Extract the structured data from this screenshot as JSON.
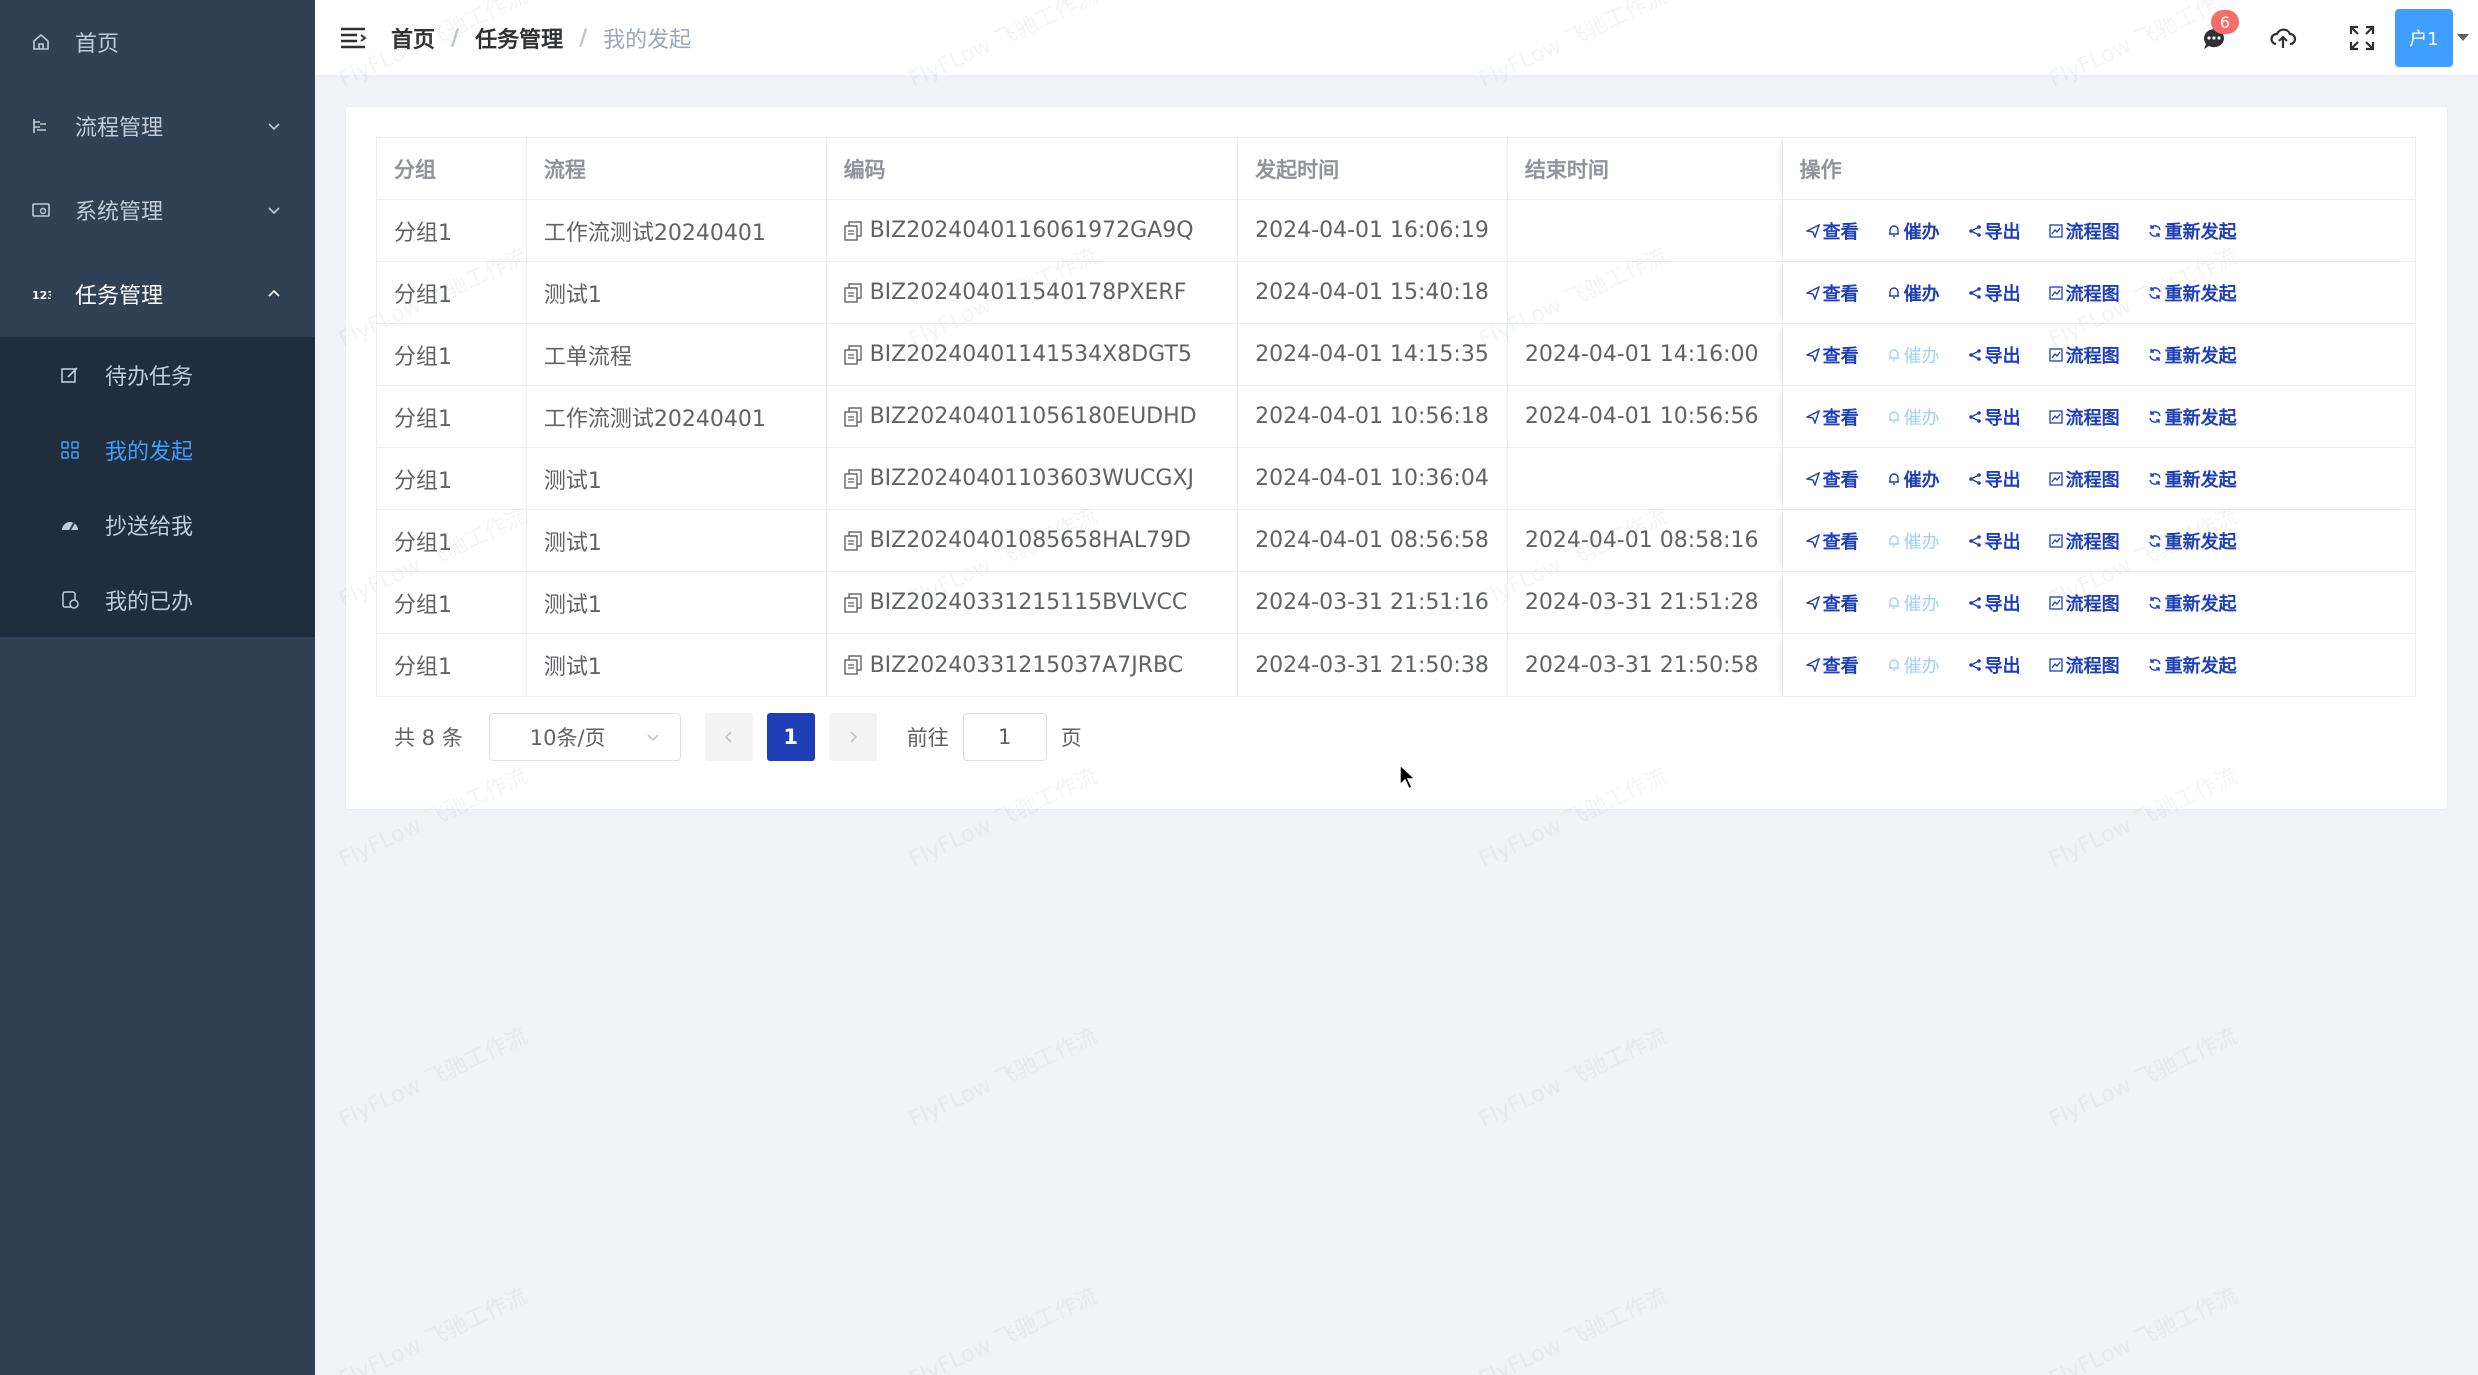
{
  "sidebar": {
    "items": [
      {
        "label": "首页",
        "icon": "home-icon"
      },
      {
        "label": "流程管理",
        "icon": "flow-icon"
      },
      {
        "label": "系统管理",
        "icon": "system-icon"
      },
      {
        "label": "任务管理",
        "icon": "task-icon"
      }
    ],
    "subitems": [
      {
        "label": "待办任务",
        "icon": "edit-icon"
      },
      {
        "label": "我的发起",
        "icon": "grid-icon"
      },
      {
        "label": "抄送给我",
        "icon": "dashboard-icon"
      },
      {
        "label": "我的已办",
        "icon": "done-icon"
      }
    ]
  },
  "header": {
    "breadcrumb": [
      "首页",
      "任务管理",
      "我的发起"
    ],
    "message_count": "6",
    "user": "户1"
  },
  "table": {
    "columns": [
      "分组",
      "流程",
      "编码",
      "发起时间",
      "结束时间",
      "操作"
    ],
    "rows": [
      {
        "group": "分组1",
        "flow": "工作流测试20240401",
        "code": "BIZ2024040116061972GA9Q",
        "start": "2024-04-01 16:06:19",
        "end": "",
        "urge_enabled": true
      },
      {
        "group": "分组1",
        "flow": "测试1",
        "code": "BIZ202404011540178PXERF",
        "start": "2024-04-01 15:40:18",
        "end": "",
        "urge_enabled": true
      },
      {
        "group": "分组1",
        "flow": "工单流程",
        "code": "BIZ20240401141534X8DGT5",
        "start": "2024-04-01 14:15:35",
        "end": "2024-04-01 14:16:00",
        "urge_enabled": false
      },
      {
        "group": "分组1",
        "flow": "工作流测试20240401",
        "code": "BIZ202404011056180EUDHD",
        "start": "2024-04-01 10:56:18",
        "end": "2024-04-01 10:56:56",
        "urge_enabled": false
      },
      {
        "group": "分组1",
        "flow": "测试1",
        "code": "BIZ20240401103603WUCGXJ",
        "start": "2024-04-01 10:36:04",
        "end": "",
        "urge_enabled": true
      },
      {
        "group": "分组1",
        "flow": "测试1",
        "code": "BIZ20240401085658HAL79D",
        "start": "2024-04-01 08:56:58",
        "end": "2024-04-01 08:58:16",
        "urge_enabled": false
      },
      {
        "group": "分组1",
        "flow": "测试1",
        "code": "BIZ20240331215115BVLVCC",
        "start": "2024-03-31 21:51:16",
        "end": "2024-03-31 21:51:28",
        "urge_enabled": false
      },
      {
        "group": "分组1",
        "flow": "测试1",
        "code": "BIZ20240331215037A7JRBC",
        "start": "2024-03-31 21:50:38",
        "end": "2024-03-31 21:50:58",
        "urge_enabled": false
      }
    ],
    "actions": {
      "view": "查看",
      "urge": "催办",
      "export": "导出",
      "diagram": "流程图",
      "restart": "重新发起"
    }
  },
  "pagination": {
    "total": "共 8 条",
    "page_size": "10条/页",
    "current_page": "1",
    "goto_label": "前往",
    "goto_value": "1",
    "page_suffix": "页"
  },
  "watermark": "FlyFLow 飞驰工作流",
  "colors": {
    "sidebar": "#304156",
    "submenu": "#1f2d3d",
    "accent": "#409eff",
    "link": "#1f3fb8",
    "badge": "#f56c6c"
  }
}
